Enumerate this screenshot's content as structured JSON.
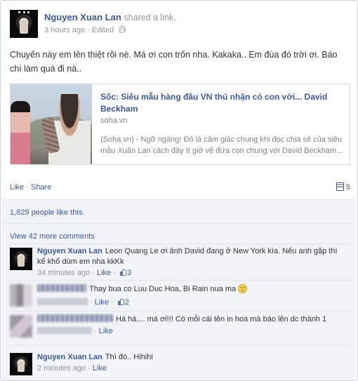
{
  "post": {
    "author": "Nguyen Xuan Lan",
    "action": "shared a link.",
    "timestamp": "3 hours ago",
    "sep": "·",
    "edited": "Edited",
    "audience_icon": "globe-icon",
    "status": "Chuyến này em lên thiệt rồi nè. Má ơi con trốn nha. Kakaka.. Em đùa đó trời ơi. Báo chí làm quá đi nà.."
  },
  "link_preview": {
    "title": "Sốc: Siêu mẫu hàng đầu VN thú nhận có con với... David Beckham",
    "domain": "soha.vn",
    "description": "(Soha.vn) - Ngỡ ngàng! Đó là cảm giác chung khi đọc chia sẻ của siêu mẫu Xuân Lan cách đây ít giờ về đứa con chung với David Beckham..."
  },
  "actions": {
    "like": "Like",
    "dot": "·",
    "share": "Share",
    "comment_count": "5",
    "comment_icon": "comment-icon"
  },
  "likes_summary": "1,829 people like this.",
  "view_more": "View 42 more comments",
  "comments": [
    {
      "author": "Nguyen Xuan Lan",
      "text": "Leon Quang Le ơi ảnh David đang ở New York kìa. Nếu anh gặp thì kể khổ dùm em nha kkKk",
      "time": "34 minutes ago",
      "like": "Like",
      "likes": "3"
    },
    {
      "author_blurred": true,
      "text": "Thay bua co Luu Duc Hoa, Bi Rain nua ma",
      "like": "Like",
      "likes": "2"
    },
    {
      "author_blurred": true,
      "text": "Há há.... má ơi!!! Có mỗi cái tên in hoa mà báo lên dc thành 1",
      "like": "Like"
    },
    {
      "author": "Nguyen Xuan Lan",
      "text": "Thì đó.. Hihihi",
      "time": "2 minutes ago",
      "like": "Like"
    }
  ],
  "colors": {
    "link": "#3b5998",
    "meta": "#90949c",
    "ufi_bg": "#f1f3f7",
    "border": "#cfd4de"
  }
}
